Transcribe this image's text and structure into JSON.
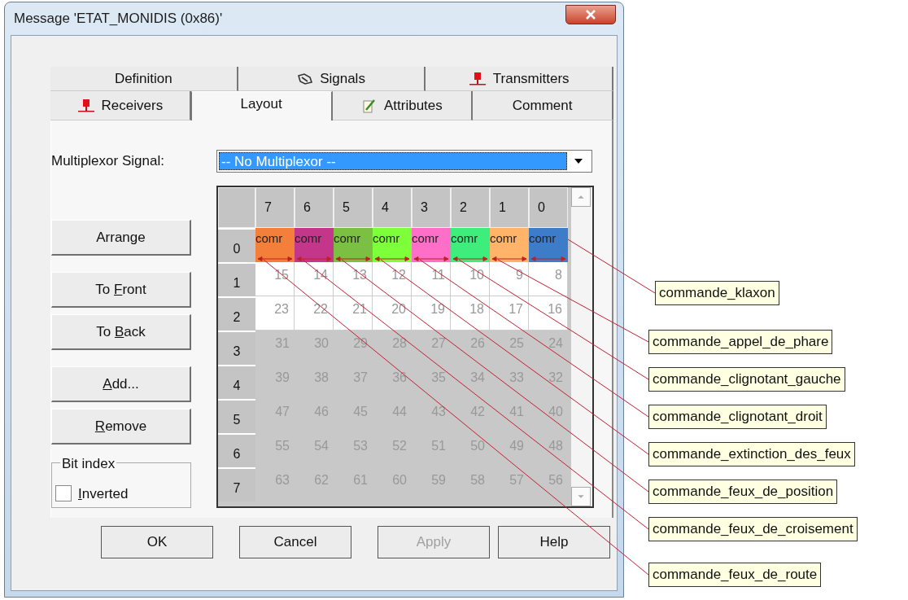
{
  "window": {
    "title": "Message 'ETAT_MONIDIS (0x86)'"
  },
  "tab_rows": [
    [
      {
        "label": "Definition",
        "kind": "plain",
        "selected": false
      },
      {
        "label": "Signals",
        "kind": "signals",
        "selected": false
      },
      {
        "label": "Transmitters",
        "kind": "node",
        "selected": false
      }
    ],
    [
      {
        "label": "Receivers",
        "kind": "node",
        "selected": false
      },
      {
        "label": "Layout",
        "kind": "plain",
        "selected": true
      },
      {
        "label": "Attributes",
        "kind": "attributes",
        "selected": false
      },
      {
        "label": "Comment",
        "kind": "plain",
        "selected": false
      }
    ]
  ],
  "multiplexor": {
    "label": "Multiplexor Signal:",
    "value": "-- No Multiplexor --"
  },
  "side_buttons": [
    {
      "before": "Arrange"
    },
    {
      "before": "To ",
      "key": "F",
      "after": "ront"
    },
    {
      "before": "To ",
      "key": "B",
      "after": "ack"
    },
    {
      "key": "A",
      "after": "dd..."
    },
    {
      "key": "R",
      "after": "emove"
    }
  ],
  "bit_index": {
    "label": "Bit index",
    "key": "I",
    "after": "nverted",
    "checked": false
  },
  "grid": {
    "columns": [
      "7",
      "6",
      "5",
      "4",
      "3",
      "2",
      "1",
      "0"
    ],
    "rows": [
      {
        "header": "0",
        "kind": "signals",
        "cells": [
          {
            "text": "comr",
            "color": "#f47f3a"
          },
          {
            "text": "comr",
            "color": "#c4368a"
          },
          {
            "text": "comr",
            "color": "#7bc043"
          },
          {
            "text": "comr",
            "color": "#7dff3a"
          },
          {
            "text": "comr",
            "color": "#ff6ec7"
          },
          {
            "text": "comr",
            "color": "#3dee7d"
          },
          {
            "text": "comr",
            "color": "#ffb46a"
          },
          {
            "text": "comr",
            "color": "#3d7cc9"
          }
        ]
      },
      {
        "header": "1",
        "kind": "free",
        "cells": [
          "15",
          "14",
          "13",
          "12",
          "11",
          "10",
          "9",
          "8"
        ]
      },
      {
        "header": "2",
        "kind": "free",
        "cells": [
          "23",
          "22",
          "21",
          "20",
          "19",
          "18",
          "17",
          "16"
        ]
      },
      {
        "header": "3",
        "kind": "unused",
        "cells": [
          "31",
          "30",
          "29",
          "28",
          "27",
          "26",
          "25",
          "24"
        ]
      },
      {
        "header": "4",
        "kind": "unused",
        "cells": [
          "39",
          "38",
          "37",
          "36",
          "35",
          "34",
          "33",
          "32"
        ]
      },
      {
        "header": "5",
        "kind": "unused",
        "cells": [
          "47",
          "46",
          "45",
          "44",
          "43",
          "42",
          "41",
          "40"
        ]
      },
      {
        "header": "6",
        "kind": "unused",
        "cells": [
          "55",
          "54",
          "53",
          "52",
          "51",
          "50",
          "49",
          "48"
        ]
      },
      {
        "header": "7",
        "kind": "unused",
        "cells": [
          "63",
          "62",
          "61",
          "60",
          "59",
          "58",
          "57",
          "56"
        ]
      }
    ]
  },
  "annotations": [
    "commande_klaxon",
    "commande_appel_de_phare",
    "commande_clignotant_gauche",
    "commande_clignotant_droit",
    "commande_extinction_des_feux",
    "commande_feux_de_position",
    "commande_feux_de_croisement",
    "commande_feux_de_route"
  ],
  "buttons": [
    {
      "label": "OK",
      "disabled": false
    },
    {
      "label": "Cancel",
      "disabled": false
    },
    {
      "label": "Apply",
      "disabled": true
    },
    {
      "label": "Help",
      "disabled": false
    }
  ]
}
